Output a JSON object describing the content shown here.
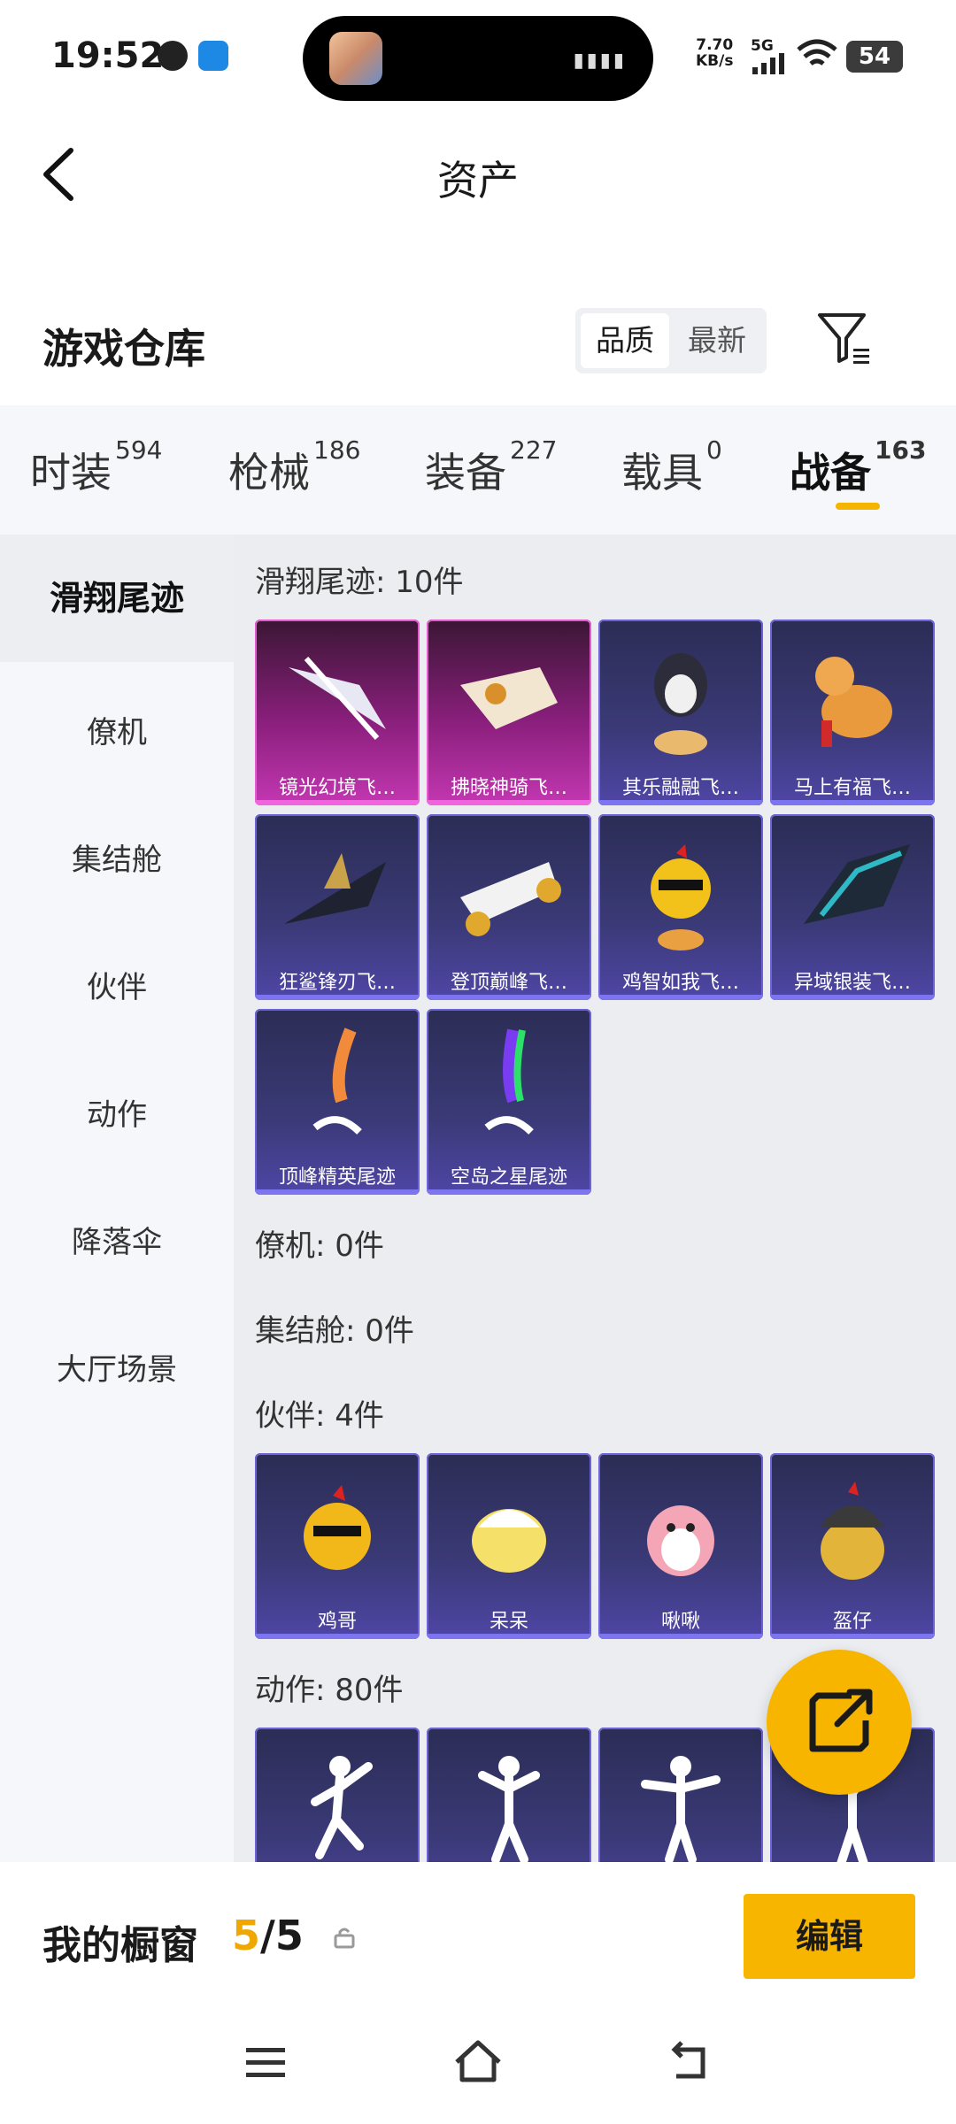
{
  "status_bar": {
    "time": "19:52",
    "net_speed_value": "7.70",
    "net_speed_unit": "KB/s",
    "signal": "5G",
    "battery": "54"
  },
  "header": {
    "title": "资产"
  },
  "warehouse": {
    "title": "游戏仓库",
    "sort_options": [
      "品质",
      "最新"
    ],
    "active_sort": "品质"
  },
  "tabs": [
    {
      "label": "时装",
      "count": "594"
    },
    {
      "label": "枪械",
      "count": "186"
    },
    {
      "label": "装备",
      "count": "227"
    },
    {
      "label": "载具",
      "count": "0"
    },
    {
      "label": "战备",
      "count": "163"
    }
  ],
  "active_tab": "战备",
  "side_nav": [
    "滑翔尾迹",
    "僚机",
    "集结舱",
    "伙伴",
    "动作",
    "降落伞",
    "大厅场景"
  ],
  "active_side": "滑翔尾迹",
  "groups": {
    "glide": {
      "title": "滑翔尾迹: 10件",
      "items": [
        {
          "name": "镜光幻境飞…",
          "quality": "pink"
        },
        {
          "name": "拂晓神骑飞…",
          "quality": "pink"
        },
        {
          "name": "其乐融融飞…",
          "quality": "purple"
        },
        {
          "name": "马上有福飞…",
          "quality": "purple"
        },
        {
          "name": "狂鲨锋刃飞…",
          "quality": "purple"
        },
        {
          "name": "登顶巅峰飞…",
          "quality": "purple"
        },
        {
          "name": "鸡智如我飞…",
          "quality": "purple"
        },
        {
          "name": "异域银装飞…",
          "quality": "purple"
        },
        {
          "name": "顶峰精英尾迹",
          "quality": "purple"
        },
        {
          "name": "空岛之星尾迹",
          "quality": "purple"
        }
      ]
    },
    "wingman": {
      "title": "僚机: 0件"
    },
    "pod": {
      "title": "集结舱: 0件"
    },
    "partner": {
      "title": "伙伴: 4件",
      "items": [
        {
          "name": "鸡哥"
        },
        {
          "name": "呆呆"
        },
        {
          "name": "啾啾"
        },
        {
          "name": "盔仔"
        }
      ]
    },
    "emote": {
      "title": "动作: 80件"
    }
  },
  "showcase": {
    "label": "我的橱窗",
    "current": "5",
    "separator": "/",
    "total": "5",
    "edit_label": "编辑"
  },
  "colors": {
    "accent": "#f7b500",
    "pink_quality": "#c437b2",
    "purple_quality": "#4f46a6"
  }
}
